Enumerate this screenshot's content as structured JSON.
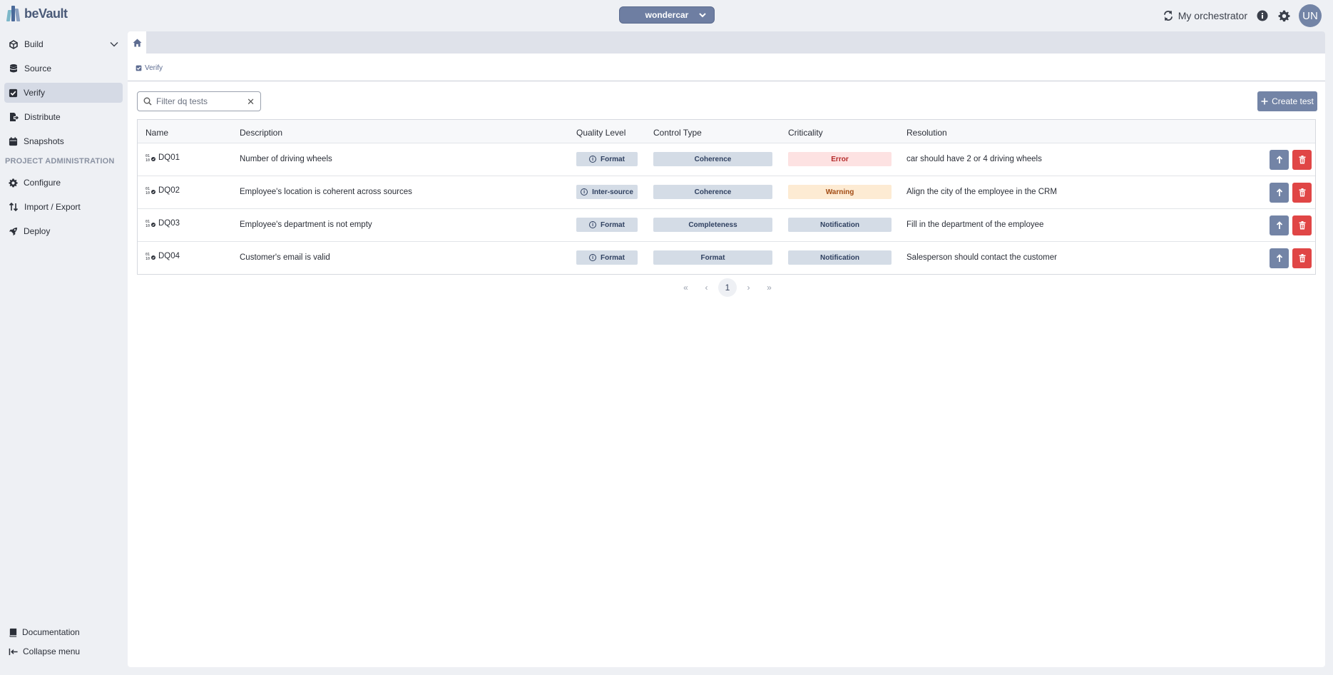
{
  "app": {
    "logo_text": "beVault",
    "logo_colors": [
      "#7db8c9",
      "#4a6a9a",
      "#8aa0c0"
    ]
  },
  "header": {
    "project": "wondercar",
    "orchestrator_label": "My orchestrator",
    "avatar_initials": "UN"
  },
  "sidebar": {
    "items": [
      {
        "label": "Build",
        "icon": "build-icon"
      },
      {
        "label": "Source",
        "icon": "database-icon"
      },
      {
        "label": "Verify",
        "icon": "checkbox-icon",
        "active": true
      },
      {
        "label": "Distribute",
        "icon": "export-file-icon"
      },
      {
        "label": "Snapshots",
        "icon": "calendar-icon"
      }
    ],
    "section_title": "PROJECT ADMINISTRATION",
    "admin_items": [
      {
        "label": "Configure",
        "icon": "gear-icon"
      },
      {
        "label": "Import / Export",
        "icon": "swap-vertical-icon"
      },
      {
        "label": "Deploy",
        "icon": "rocket-icon"
      }
    ],
    "footer": {
      "documentation": "Documentation",
      "collapse": "Collapse menu"
    }
  },
  "breadcrumb": {
    "label": "Verify"
  },
  "search": {
    "placeholder": "Filter dq tests",
    "value": ""
  },
  "toolbar": {
    "create_label": "Create test"
  },
  "table": {
    "columns": [
      "Name",
      "Description",
      "Quality Level",
      "Control Type",
      "Criticality",
      "Resolution"
    ],
    "rows": [
      {
        "name": "DQ01",
        "description": "Number of driving wheels",
        "quality_level": "Format",
        "control_type": "Coherence",
        "criticality": "Error",
        "resolution": "car should have 2 or 4 driving wheels"
      },
      {
        "name": "DQ02",
        "description": "Employee's location is coherent across sources",
        "quality_level": "Inter-source",
        "control_type": "Coherence",
        "criticality": "Warning",
        "resolution": "Align the city of the employee in the CRM"
      },
      {
        "name": "DQ03",
        "description": "Employee's department is not empty",
        "quality_level": "Format",
        "control_type": "Completeness",
        "criticality": "Notification",
        "resolution": "Fill in the department of the employee"
      },
      {
        "name": "DQ04",
        "description": "Customer's email is valid",
        "quality_level": "Format",
        "control_type": "Format",
        "criticality": "Notification",
        "resolution": "Salesperson should contact the customer"
      }
    ]
  },
  "criticality_colors": {
    "Error": {
      "bg": "#fde2e2",
      "fg": "#b42a2a"
    },
    "Warning": {
      "bg": "#fdebd3",
      "fg": "#a14a12"
    },
    "Notification": {
      "bg": "#d4dce6",
      "fg": "#2f4060"
    }
  },
  "pager": {
    "first": "«",
    "prev": "‹",
    "current": "1",
    "next": "›",
    "last": "»"
  }
}
